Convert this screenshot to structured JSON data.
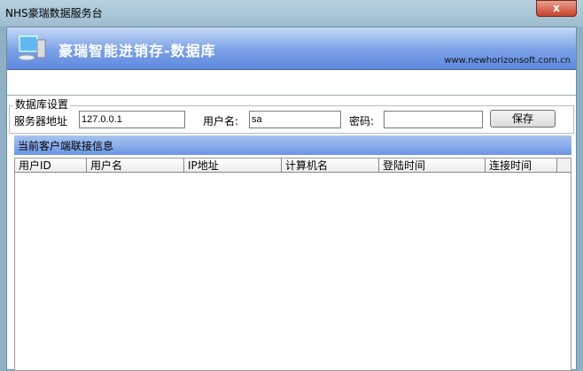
{
  "window": {
    "title": "NHS豪瑞数据服务台",
    "close_label": "x"
  },
  "banner": {
    "title": "豪瑞智能进销存-数据库",
    "url": "www.newhorizonsoft.com.cn"
  },
  "settings": {
    "group_label": "数据库设置",
    "server_label": "服务器地址",
    "server_value": "127.0.0.1",
    "user_label": "用户名:",
    "user_value": "sa",
    "password_label": "密码:",
    "password_value": "",
    "save_label": "保存"
  },
  "clients": {
    "title": "当前客户端联接信息",
    "columns": [
      "用户ID",
      "用户名",
      "IP地址",
      "计算机名",
      "登陆时间",
      "连接时间"
    ],
    "rows": []
  }
}
